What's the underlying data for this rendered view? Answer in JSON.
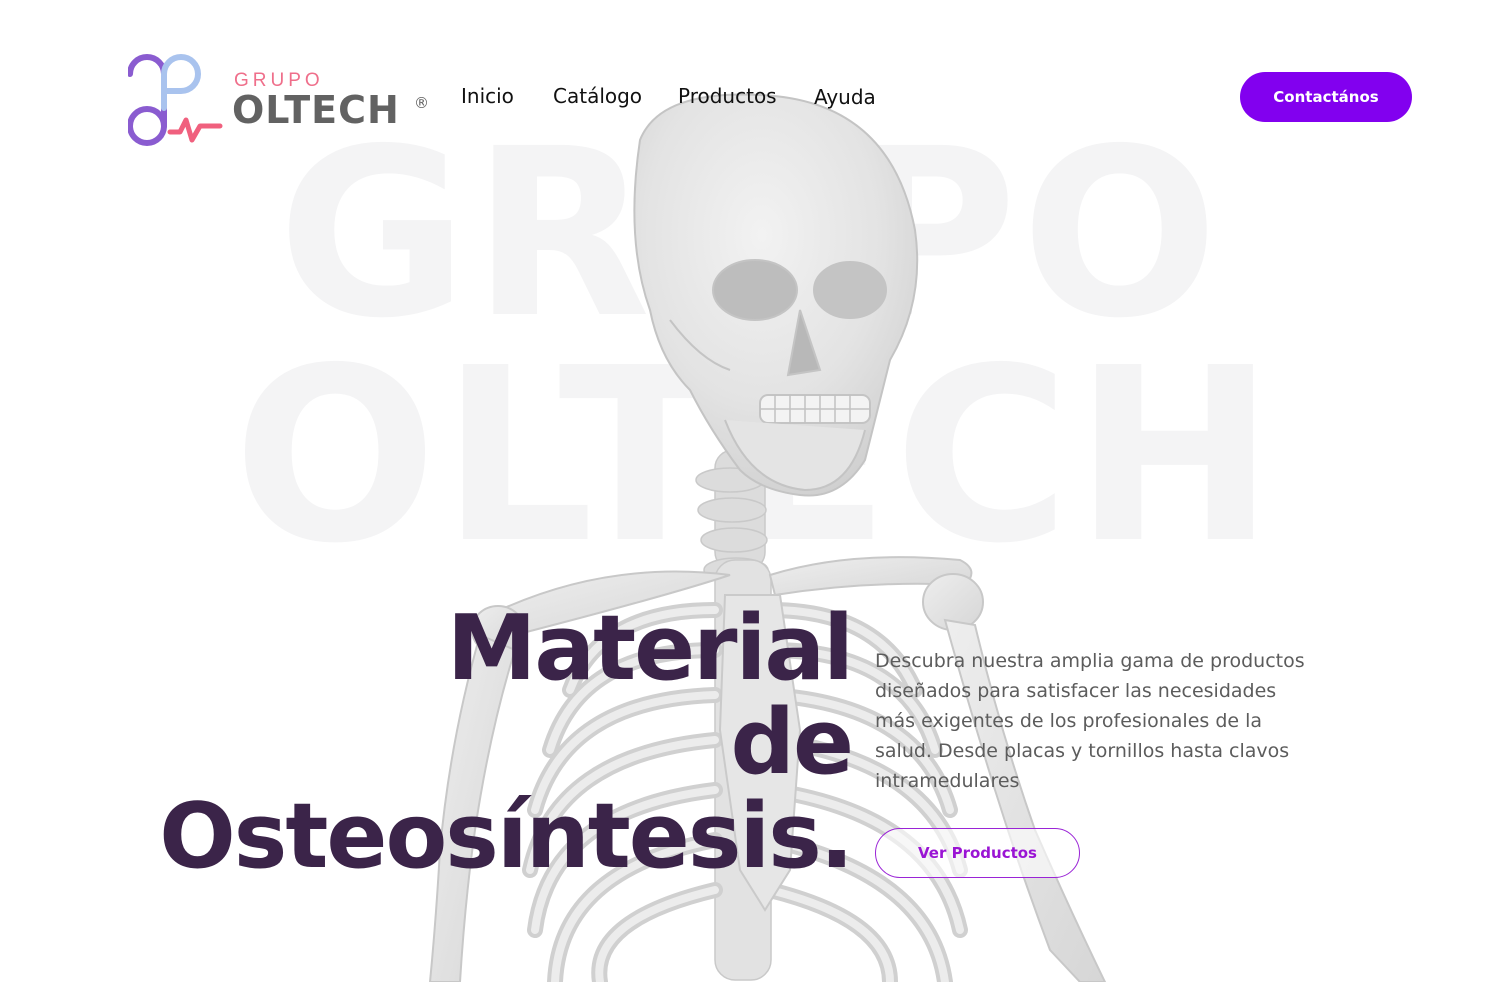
{
  "brand": {
    "word_top": "GRUPO",
    "word_main": "OLTECH",
    "registered": "®",
    "colors": {
      "purple": "#8a5cd0",
      "light_blue": "#a9c3ee",
      "pink": "#f0607e",
      "gray": "#626262"
    }
  },
  "nav": {
    "items": [
      {
        "label": "Inicio"
      },
      {
        "label": "Catálogo"
      },
      {
        "label": "Productos"
      },
      {
        "label": "Ayuda"
      }
    ]
  },
  "header": {
    "contact_label": "Contactános"
  },
  "watermark": {
    "line1": "GRUPO",
    "line2": "OLTECH"
  },
  "hero": {
    "title_lines": [
      "Material",
      "de",
      "Osteosíntesis."
    ],
    "description": "Descubra nuestra amplia gama de productos diseñados para satisfacer las necesidades más exigentes de los profesionales de la salud. Desde placas y tornillos hasta clavos intramedulares",
    "cta_label": "Ver Productos"
  },
  "colors": {
    "accent": "#8200ef",
    "title": "#3b2449",
    "text": "#5c5c5c",
    "watermark": "#f4f4f5"
  }
}
